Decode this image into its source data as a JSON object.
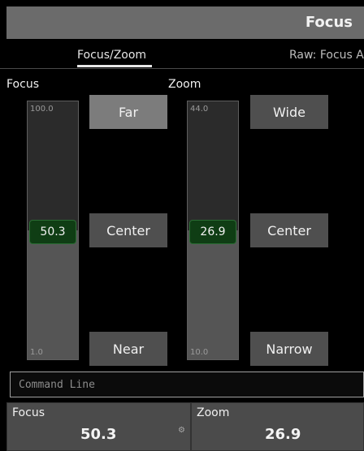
{
  "window": {
    "title": "Focus"
  },
  "tabs": [
    {
      "label": "Focus/Zoom",
      "active": true
    },
    {
      "label": "Raw: Focus A",
      "active": false
    }
  ],
  "focus": {
    "label": "Focus",
    "max": "100.0",
    "min": "1.0",
    "value": "50.3",
    "level_fraction": 0.5,
    "buttons": {
      "top": "Far",
      "middle": "Center",
      "bottom": "Near"
    }
  },
  "zoom": {
    "label": "Zoom",
    "max": "44.0",
    "min": "10.0",
    "value": "26.9",
    "level_fraction": 0.5,
    "buttons": {
      "top": "Wide",
      "middle": "Center",
      "bottom": "Narrow"
    }
  },
  "command_line": {
    "placeholder": "Command Line"
  },
  "bottom": {
    "focus": {
      "label": "Focus",
      "value": "50.3"
    },
    "zoom": {
      "label": "Zoom",
      "value": "26.9"
    }
  },
  "icons": {
    "settings": "gear-icon"
  },
  "colors": {
    "title_bar": "#6b6b6b",
    "knob_green": "#0f3d14",
    "button": "#4f4f4f"
  }
}
